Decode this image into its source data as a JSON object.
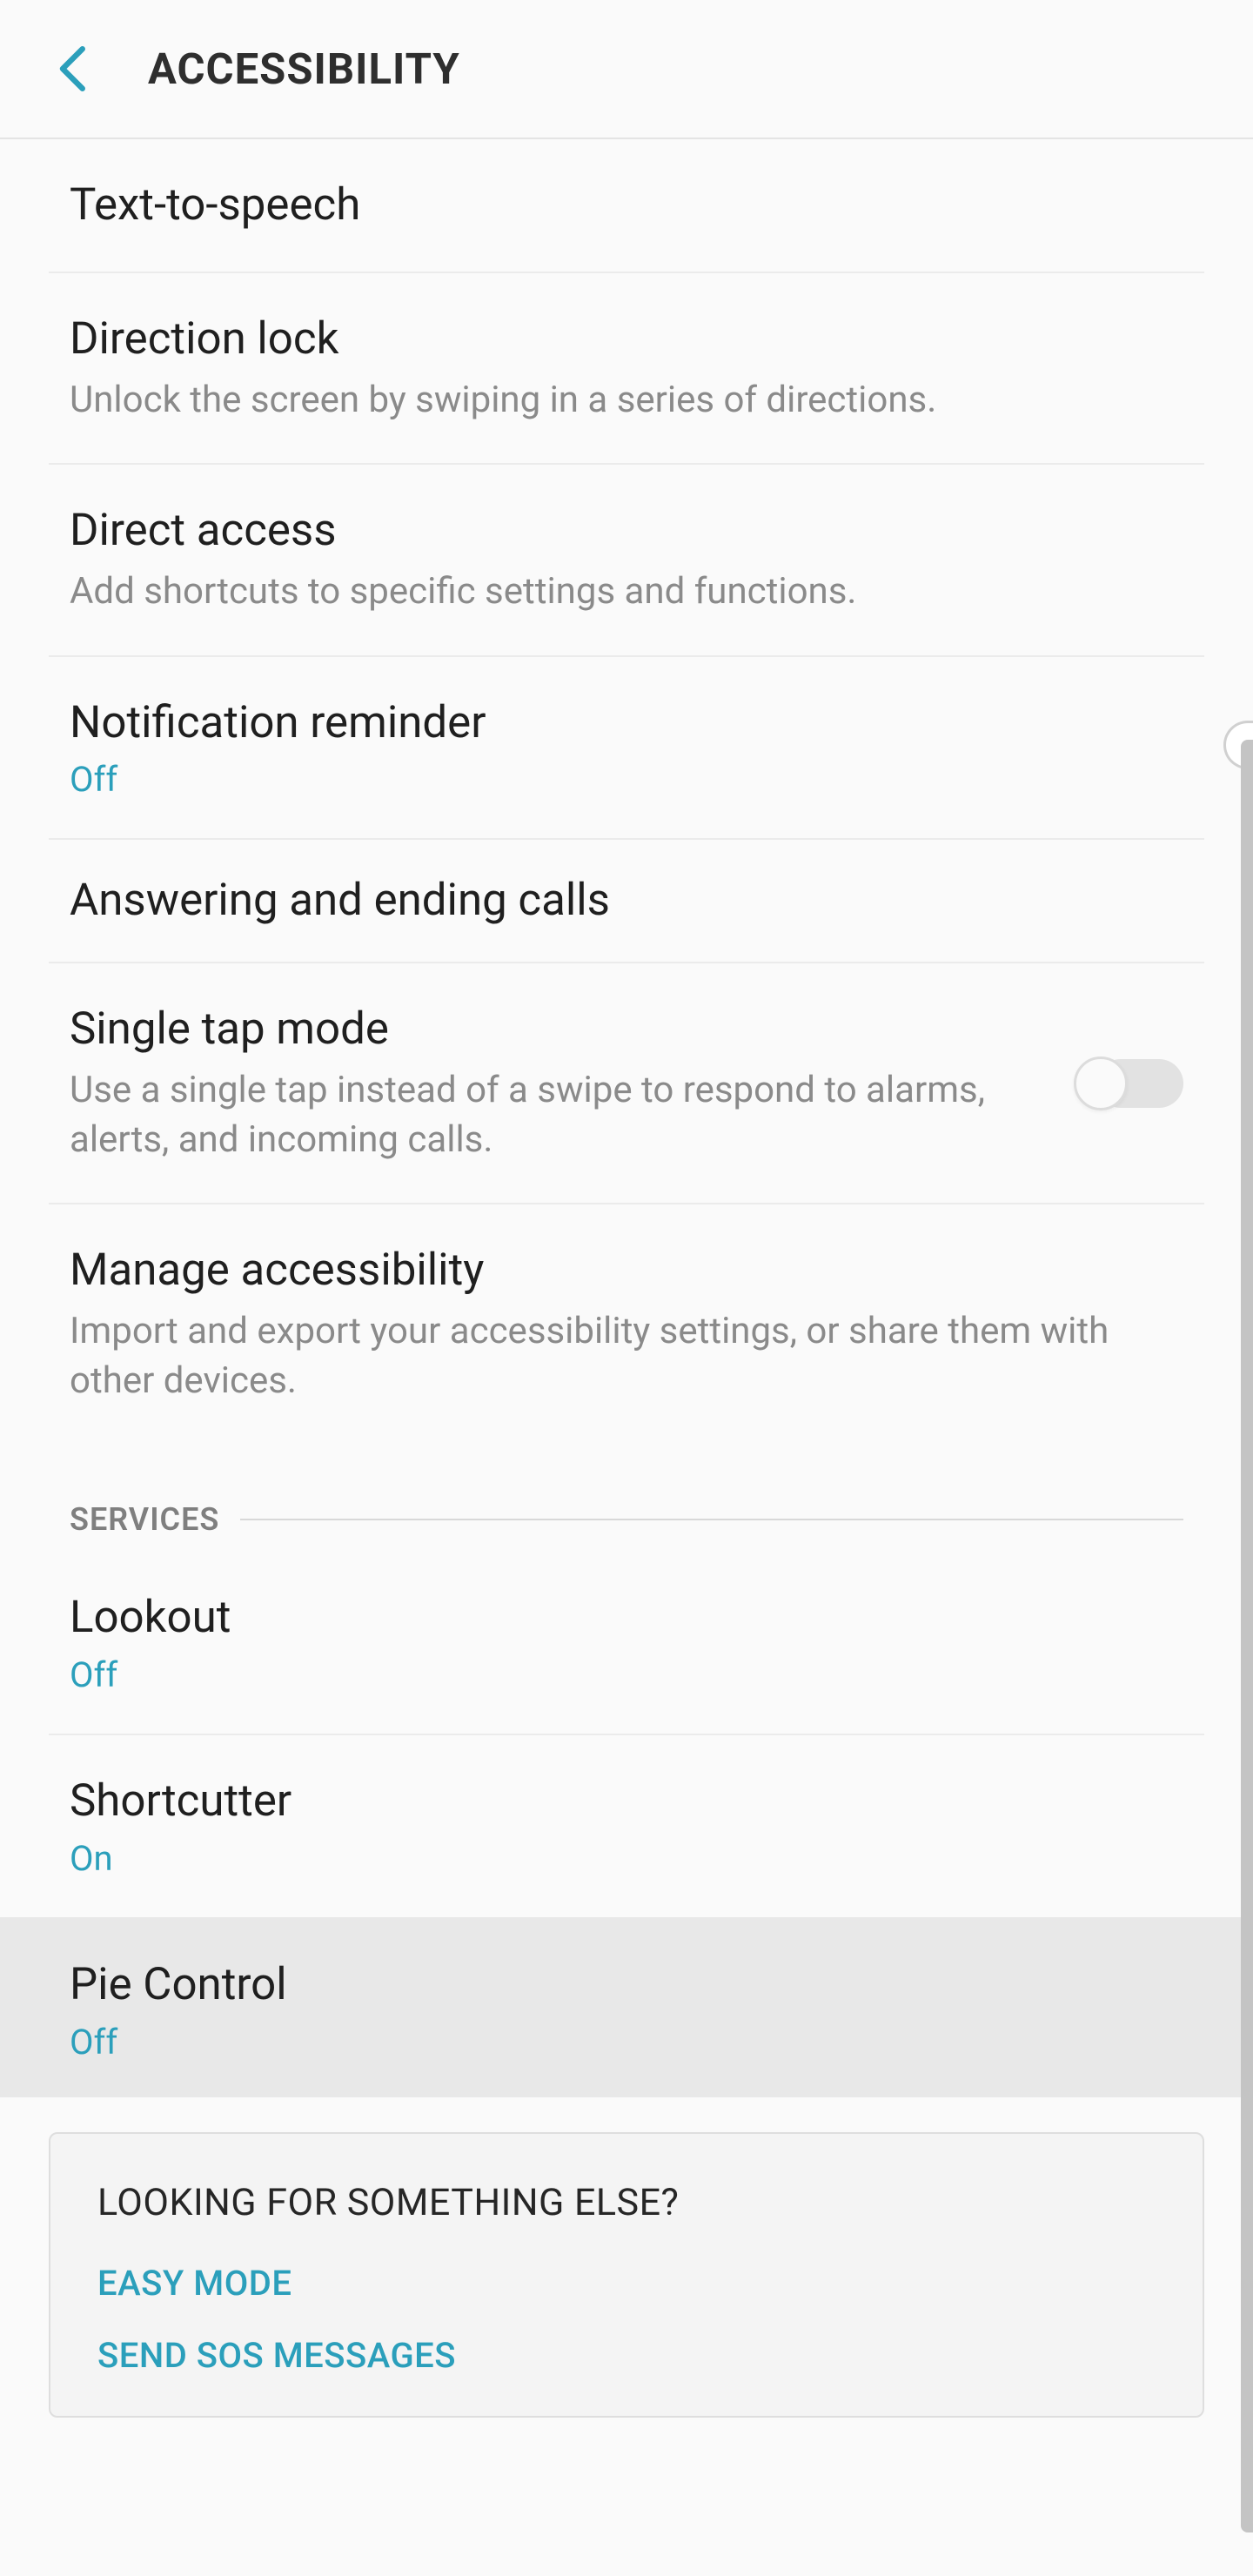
{
  "header": {
    "title": "ACCESSIBILITY"
  },
  "rows": {
    "text_to_speech": {
      "title": "Text-to-speech"
    },
    "direction_lock": {
      "title": "Direction lock",
      "sub": "Unlock the screen by swiping in a series of directions."
    },
    "direct_access": {
      "title": "Direct access",
      "sub": "Add shortcuts to specific settings and functions."
    },
    "notification_reminder": {
      "title": "Notification reminder",
      "status": "Off"
    },
    "answering_calls": {
      "title": "Answering and ending calls"
    },
    "single_tap": {
      "title": "Single tap mode",
      "sub": "Use a single tap instead of a swipe to respond to alarms, alerts, and incoming calls.",
      "toggle": false
    },
    "manage_accessibility": {
      "title": "Manage accessibility",
      "sub": "Import and export your accessibility settings, or share them with other devices."
    }
  },
  "section": {
    "services": "SERVICES"
  },
  "services": {
    "lookout": {
      "title": "Lookout",
      "status": "Off"
    },
    "shortcutter": {
      "title": "Shortcutter",
      "status": "On"
    },
    "pie_control": {
      "title": "Pie Control",
      "status": "Off"
    }
  },
  "footer": {
    "title": "LOOKING FOR SOMETHING ELSE?",
    "links": {
      "easy_mode": "EASY MODE",
      "send_sos": "SEND SOS MESSAGES"
    }
  }
}
